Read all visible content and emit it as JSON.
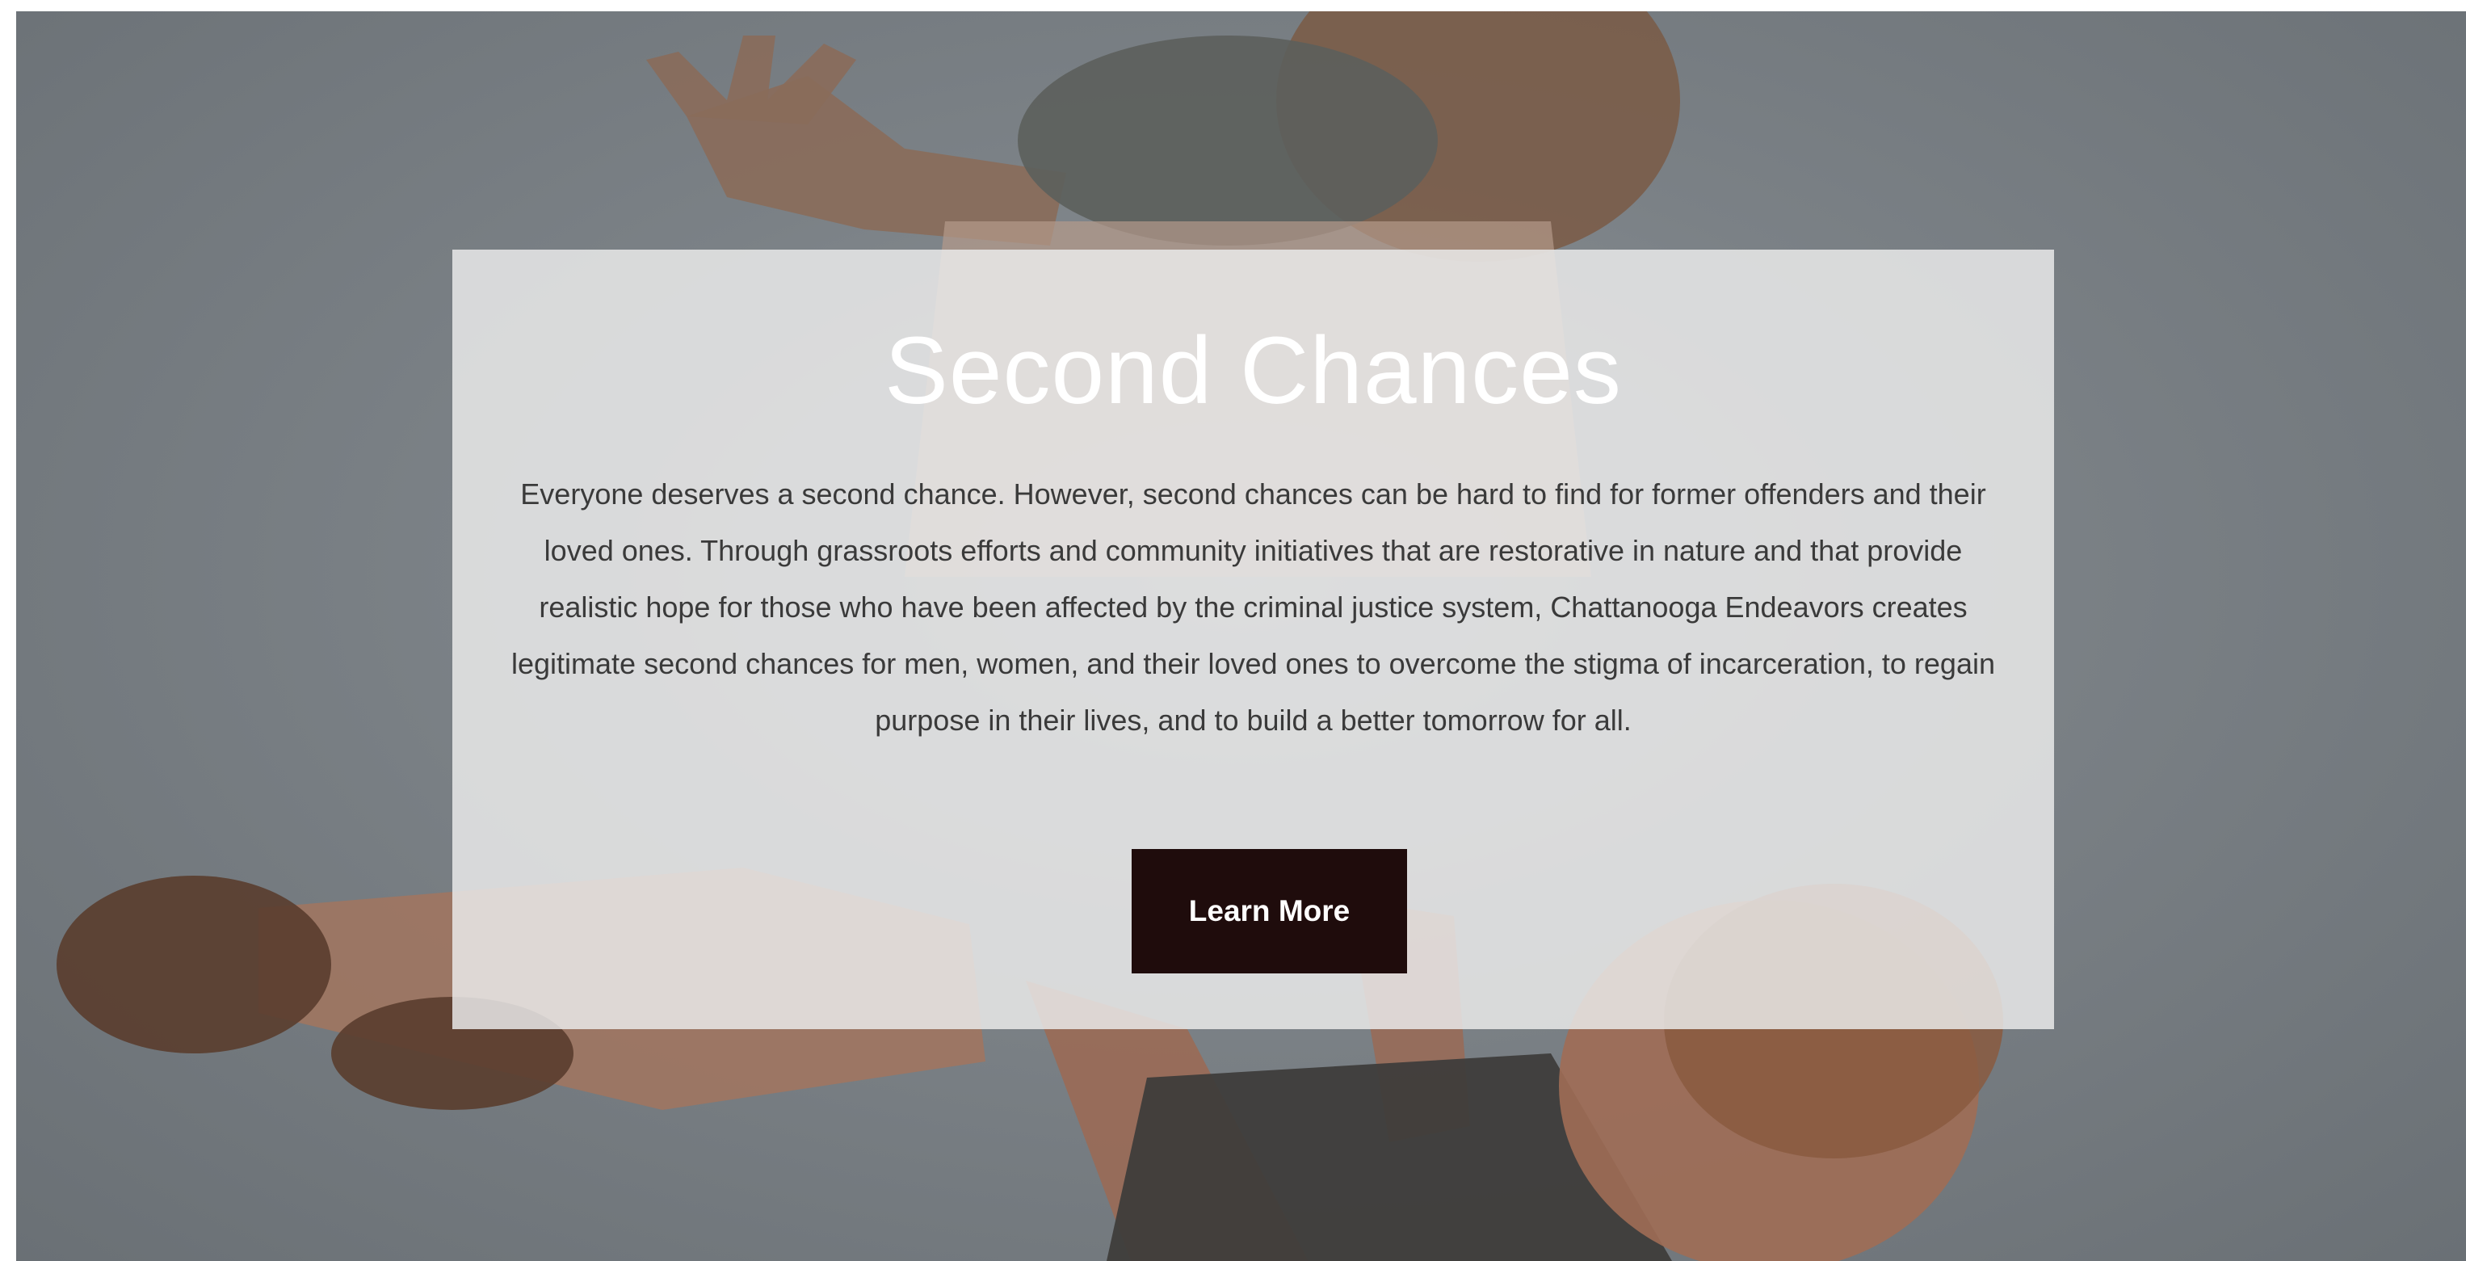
{
  "hero": {
    "background_image": "parent-lifting-child-photo",
    "title": "Second Chances",
    "body": "Everyone deserves a second chance. However, second chances can be hard to find for former offenders and their loved ones. Through grassroots efforts and community initiatives that are restorative in nature and that provide realistic hope for those who have been affected by the criminal justice system, Chattanooga Endeavors creates legitimate second chances for men, women, and their loved ones to overcome the stigma of incarceration, to regain purpose in their lives, and to build a better tomorrow for all.",
    "cta_label": "Learn More"
  },
  "colors": {
    "button_bg": "#1f0c0c",
    "card_bg": "#ebebeb",
    "title_text": "#ffffff",
    "body_text": "#3a3a3a"
  }
}
